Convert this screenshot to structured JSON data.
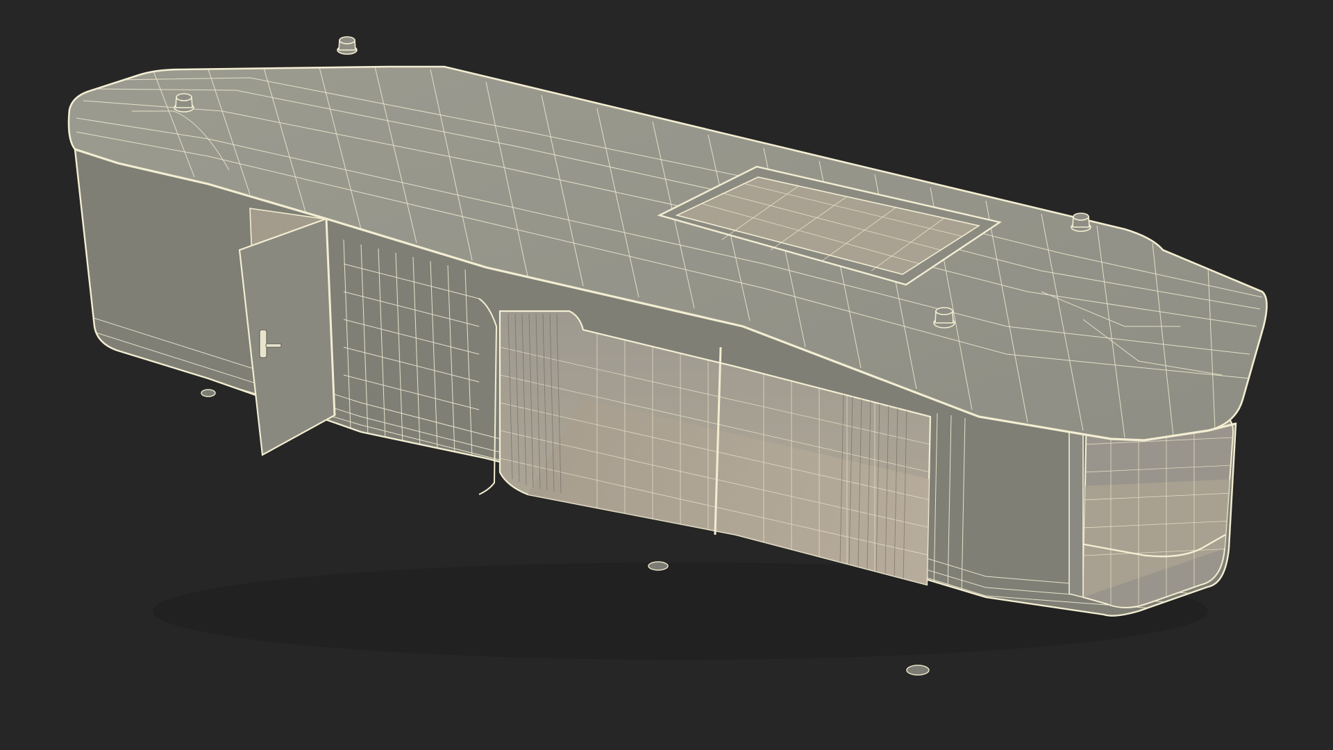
{
  "scene": {
    "subject": "modular-capsule-house-wireframe",
    "background_color": "#262626",
    "surface_color": "#8a8a80",
    "roof_color": "#96968b",
    "side_color": "#7f7f76",
    "end_color": "#85857b",
    "glass_color": "#b1a99a",
    "interior_color": "#a59b8c",
    "wire_color": "#f3eed2",
    "door_color": "#898980",
    "icons": [
      "door-handle-icon",
      "roof-vent-icon",
      "skylight-icon"
    ]
  }
}
